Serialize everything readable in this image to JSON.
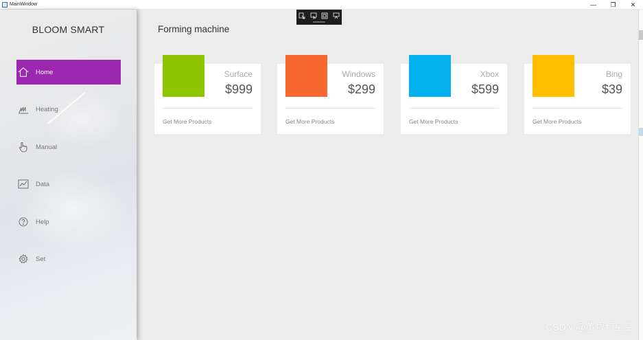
{
  "window": {
    "title": "MainWindow",
    "controls": [
      "—",
      "❐",
      "✕"
    ]
  },
  "sidebar": {
    "brand": "BLOOM SMART",
    "accent_color": "#9c27b0",
    "items": [
      {
        "label": "Home",
        "icon": "home-icon",
        "active": true
      },
      {
        "label": "Heating",
        "icon": "heating-icon",
        "active": false
      },
      {
        "label": "Manual",
        "icon": "hand-pointer-icon",
        "active": false
      },
      {
        "label": "Data",
        "icon": "chart-icon",
        "active": false
      },
      {
        "label": "Help",
        "icon": "help-icon",
        "active": false
      },
      {
        "label": "Set",
        "icon": "gear-icon",
        "active": false
      }
    ]
  },
  "main": {
    "title": "Forming machine",
    "cards": [
      {
        "name": "Surface",
        "price": "$999",
        "color": "#8fc400",
        "link": "Get More Products"
      },
      {
        "name": "Windows",
        "price": "$299",
        "color": "#f7672f",
        "link": "Get More Products"
      },
      {
        "name": "Xbox",
        "price": "$599",
        "color": "#03b0ee",
        "link": "Get More Products"
      },
      {
        "name": "Bing",
        "price": "$39",
        "color": "#ffbf00",
        "link": "Get More Products"
      }
    ]
  },
  "watermark": "CSDN @黄昏和星空"
}
